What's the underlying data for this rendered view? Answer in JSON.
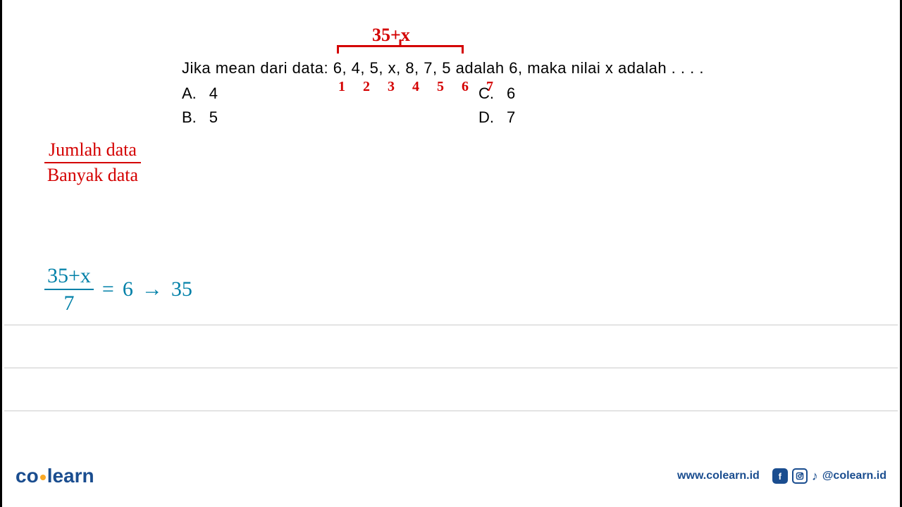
{
  "annotations": {
    "sum": "35+x",
    "count": "1 2 3 4 5 6 7"
  },
  "question": {
    "text": "Jika mean dari data: 6, 4, 5, x, 8, 7, 5 adalah 6, maka nilai x adalah . . . .",
    "options": {
      "a": {
        "label": "A.",
        "value": "4"
      },
      "b": {
        "label": "B.",
        "value": "5"
      },
      "c": {
        "label": "C.",
        "value": "6"
      },
      "d": {
        "label": "D.",
        "value": "7"
      }
    }
  },
  "formula_red": {
    "numerator": "Jumlah data",
    "denominator": "Banyak data"
  },
  "work_blue": {
    "frac_num": "35+x",
    "frac_den": "7",
    "equals": "=",
    "result": "6",
    "arrow": "→",
    "next": "35"
  },
  "footer": {
    "logo_left": "co",
    "logo_right": "learn",
    "website": "www.colearn.id",
    "handle": "@colearn.id"
  }
}
